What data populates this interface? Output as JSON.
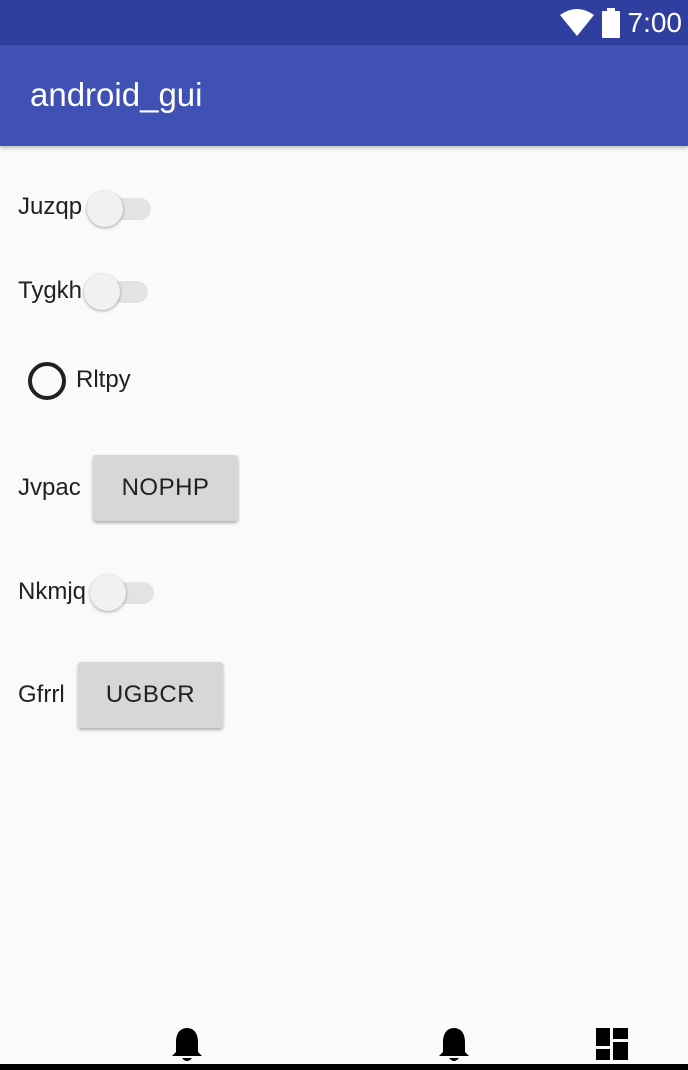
{
  "status_bar": {
    "time": "7:00"
  },
  "app_bar": {
    "title": "android_gui"
  },
  "rows": [
    {
      "label": "Juzqp",
      "type": "switch",
      "checked": false
    },
    {
      "label": "Tygkh",
      "type": "switch",
      "checked": false
    },
    {
      "label": "Rltpy",
      "type": "radio",
      "checked": false
    },
    {
      "label": "Jvpac",
      "type": "button",
      "button_label": "NOPHP"
    },
    {
      "label": "Nkmjq",
      "type": "switch",
      "checked": false
    },
    {
      "label": "Gfrrl",
      "type": "button",
      "button_label": "UGBCR"
    }
  ],
  "nav_bar": {
    "icons": [
      "bell-icon",
      "bell-icon",
      "dashboard-icon"
    ]
  }
}
